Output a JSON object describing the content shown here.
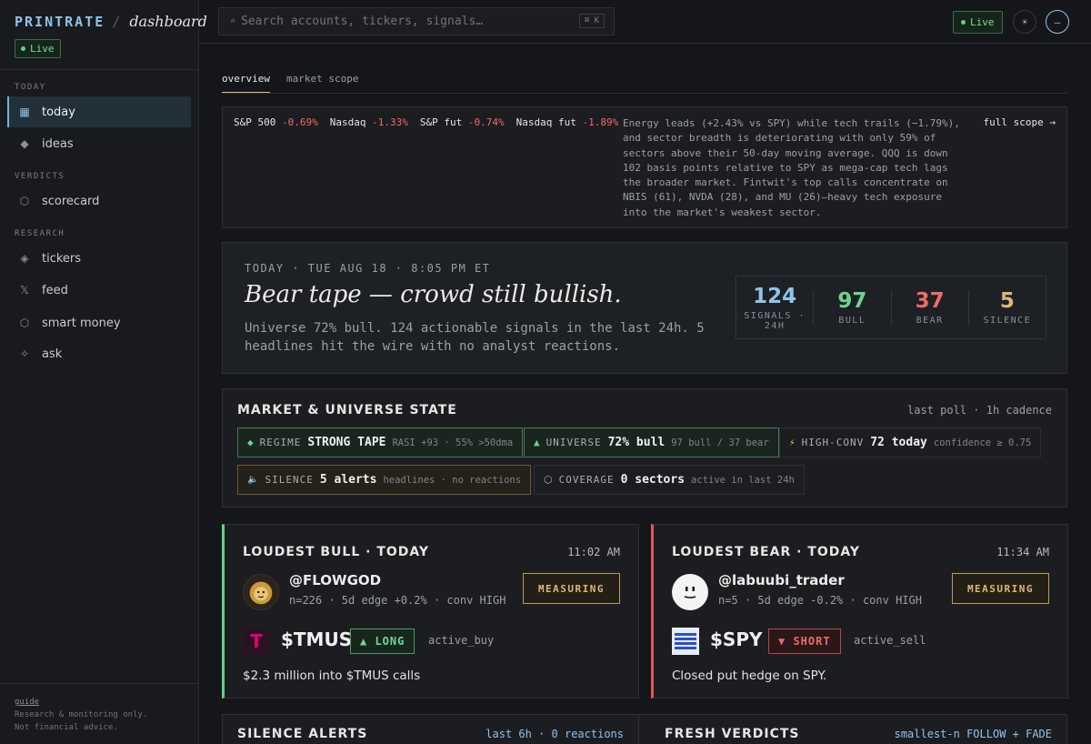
{
  "brand": {
    "name": "PRINTRATE",
    "sep": "/",
    "section": "dashboard",
    "live": "Live"
  },
  "sidebar": {
    "sections": [
      "TODAY",
      "VERDICTS",
      "RESEARCH"
    ],
    "items": [
      {
        "label": "today",
        "icon": "grid-icon",
        "glyph": "▦"
      },
      {
        "label": "ideas",
        "icon": "diamond-icon",
        "glyph": "◆"
      },
      {
        "label": "scorecard",
        "icon": "hexagon-icon",
        "glyph": "⬡"
      },
      {
        "label": "tickers",
        "icon": "diamond-dot-icon",
        "glyph": "◈"
      },
      {
        "label": "feed",
        "icon": "x-logo-icon",
        "glyph": "𝕏"
      },
      {
        "label": "smart money",
        "icon": "hexagon-outline-icon",
        "glyph": "⬡"
      },
      {
        "label": "ask",
        "icon": "sparkle-icon",
        "glyph": "✧"
      }
    ],
    "footer": {
      "link": "guide",
      "line1": "Research & monitoring only.",
      "line2": "Not financial advice."
    }
  },
  "topbar": {
    "search_placeholder": "Search accounts, tickers, signals…",
    "search_shortcut": "⌘ K",
    "live": "Live",
    "theme_glyph": "☀",
    "user_glyph": "–"
  },
  "tabs": [
    "overview",
    "market scope"
  ],
  "ticker": {
    "quotes": [
      {
        "name": "S&P 500",
        "chg": "-0.69%"
      },
      {
        "name": "Nasdaq",
        "chg": "-1.33%"
      },
      {
        "name": "S&P fut",
        "chg": "-0.74%"
      },
      {
        "name": "Nasdaq fut",
        "chg": "-1.89%"
      }
    ],
    "summary": "Energy leads (+2.43% vs SPY) while tech trails (−1.79%), and sector breadth is deteriorating with only 59% of sectors above their 50-day moving average. QQQ is down 102 basis points relative to SPY as mega-cap tech lags the broader market. Fintwit's top calls concentrate on NBIS (61), NVDA (28), and MU (26)—heavy tech exposure into the market's weakest sector.",
    "full_scope": "full scope →"
  },
  "hero": {
    "kicker": "TODAY · TUE AUG 18 · 8:05 PM ET",
    "title": "Bear tape — crowd still bullish.",
    "sub": "Universe 72% bull. 124 actionable signals in the last 24h. 5 headlines hit the wire with no analyst reactions.",
    "stats": [
      {
        "num": "124",
        "label": "SIGNALS · 24H",
        "color": "#8fc4e8"
      },
      {
        "num": "97",
        "label": "BULL",
        "color": "#6fd38f"
      },
      {
        "num": "37",
        "label": "BEAR",
        "color": "#ef6a6a"
      },
      {
        "num": "5",
        "label": "SILENCE",
        "color": "#d9b87a"
      }
    ]
  },
  "market_state": {
    "title": "MARKET & UNIVERSE STATE",
    "meta": "last poll · 1h cadence",
    "chips": [
      {
        "glyph": "◆",
        "key": "REGIME",
        "value": "STRONG TAPE",
        "sub": "RASI +93 · 55% >50dma"
      },
      {
        "glyph": "▲",
        "key": "UNIVERSE",
        "value": "72% bull",
        "sub": "97 bull / 37 bear"
      },
      {
        "glyph": "⚡",
        "key": "HIGH-CONV",
        "value": "72 today",
        "sub": "confidence ≥ 0.75"
      },
      {
        "glyph": "🔈",
        "key": "SILENCE",
        "value": "5 alerts",
        "sub": "headlines · no reactions"
      },
      {
        "glyph": "⬡",
        "key": "COVERAGE",
        "value": "0 sectors",
        "sub": "active in last 24h"
      }
    ]
  },
  "loudest_bull": {
    "title": "LOUDEST BULL · TODAY",
    "time": "11:02 AM",
    "handle": "@FLOWGOD",
    "stats": "n=226 · 5d edge +0.2% · conv HIGH",
    "status": "MEASURING",
    "ticker": "$TMUS",
    "direction": "▲ LONG",
    "action": "active_buy",
    "note": "$2.3 million into $TMUS calls",
    "logo": "T"
  },
  "loudest_bear": {
    "title": "LOUDEST BEAR · TODAY",
    "time": "11:34 AM",
    "handle": "@labuubi_trader",
    "stats": "n=5 · 5d edge -0.2% · conv HIGH",
    "status": "MEASURING",
    "ticker": "$SPY",
    "direction": "▼ SHORT",
    "action": "active_sell",
    "note": "Closed put hedge on SPY."
  },
  "silence_alerts": {
    "title": "SILENCE ALERTS",
    "meta": "last 6h · 0 reactions"
  },
  "fresh_verdicts": {
    "title": "FRESH VERDICTS",
    "meta": "smallest-n FOLLOW + FADE"
  },
  "colors": {
    "accent": "#8fc4e8",
    "bull": "#6fd38f",
    "bear": "#ef6a6a",
    "amber": "#d9b87a"
  }
}
